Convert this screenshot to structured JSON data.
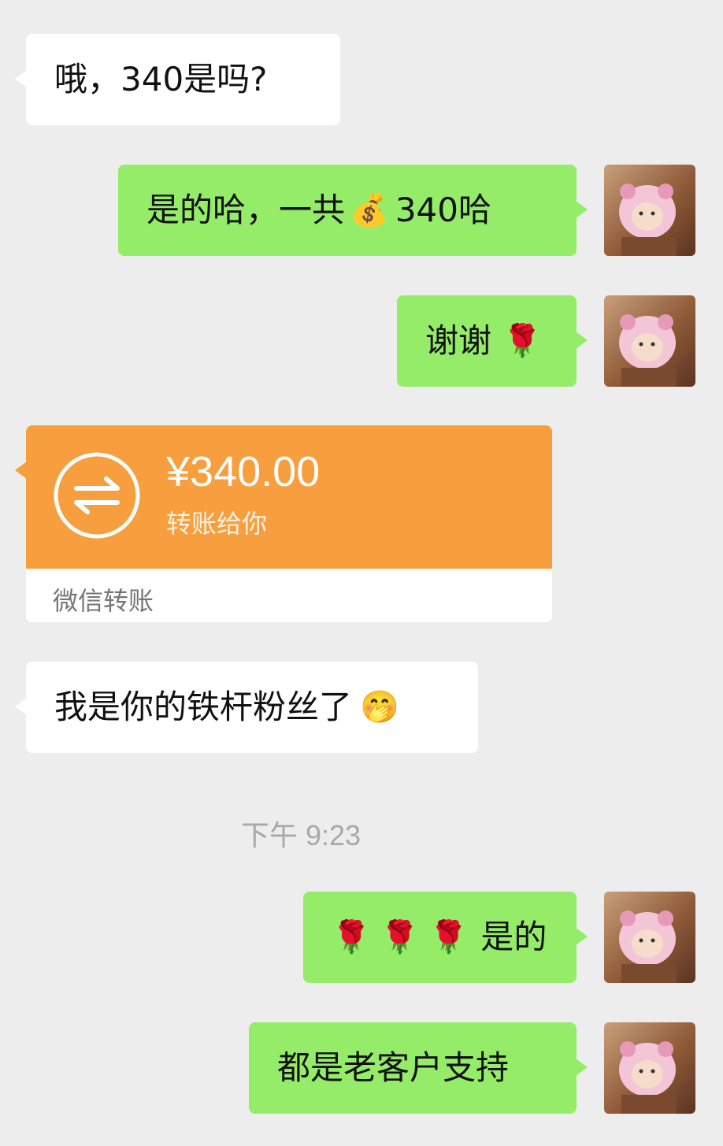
{
  "messages": [
    {
      "side": "left",
      "text": "哦，340是吗?"
    },
    {
      "side": "right",
      "text_before": "是的哈，一共",
      "emoji": "💰",
      "text_after": "340哈"
    },
    {
      "side": "right",
      "text": "谢谢",
      "emoji": "🌹"
    },
    {
      "side": "left",
      "type": "transfer"
    },
    {
      "side": "left",
      "text": "我是你的铁杆粉丝了",
      "emoji": "🤭"
    },
    {
      "side": "right",
      "emoji": "🌹🌹🌹",
      "text": "是的"
    },
    {
      "side": "right",
      "text": "都是老客户支持"
    }
  ],
  "transfer": {
    "amount": "¥340.00",
    "description": "转账给你",
    "label": "微信转账",
    "icon": "transfer-arrows-icon"
  },
  "timestamp": "下午 9:23",
  "colors": {
    "background": "#ededed",
    "bubble_self": "#95ec69",
    "bubble_other": "#ffffff",
    "transfer_orange": "#f79e3e"
  }
}
